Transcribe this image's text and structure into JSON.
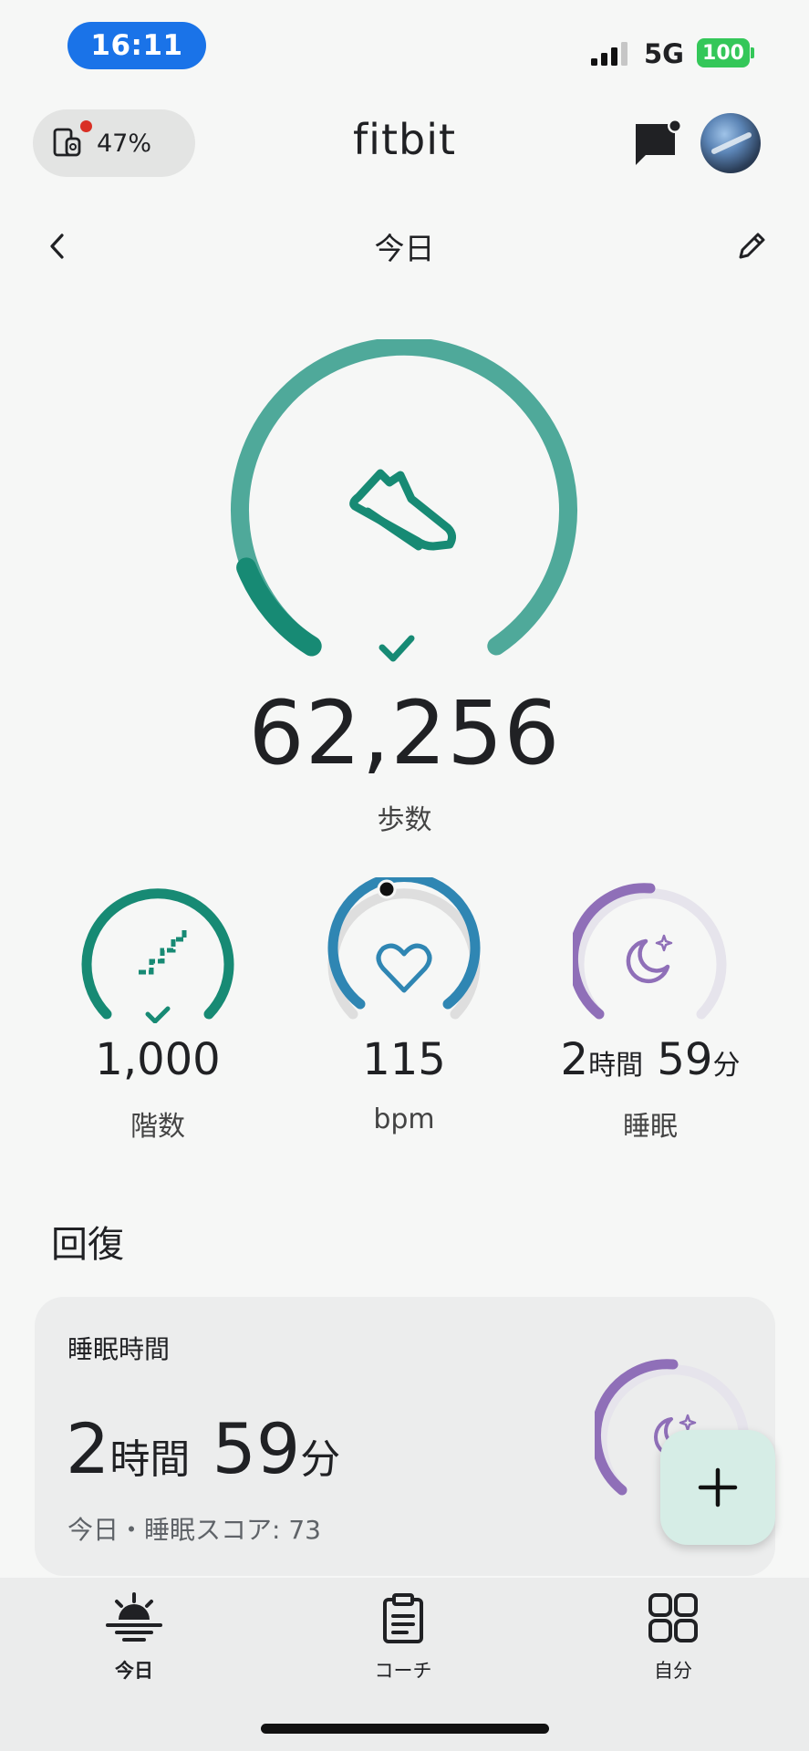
{
  "status_bar": {
    "time": "16:11",
    "network": "5G",
    "battery": "100"
  },
  "header": {
    "device_battery": "47%",
    "brand": "fitbit"
  },
  "date_nav": {
    "title": "今日"
  },
  "steps": {
    "value": "62,256",
    "label": "歩数",
    "goal_met": true
  },
  "stats": {
    "floors": {
      "value": "1,000",
      "label": "階数",
      "goal_met": true
    },
    "heart": {
      "value": "115",
      "label": "bpm"
    },
    "sleep": {
      "hours": "2",
      "hours_unit": "時間",
      "minutes": "59",
      "minutes_unit": "分",
      "label": "睡眠"
    }
  },
  "recovery": {
    "section_title": "回復",
    "card_title": "睡眠時間",
    "hours": "2",
    "hours_unit": "時間",
    "minutes": "59",
    "minutes_unit": "分",
    "subtitle": "今日・睡眠スコア: 73"
  },
  "bottom_nav": {
    "tabs": [
      {
        "label": "今日",
        "icon": "sunrise-icon",
        "active": true
      },
      {
        "label": "コーチ",
        "icon": "clipboard-icon",
        "active": false
      },
      {
        "label": "自分",
        "icon": "grid-icon",
        "active": false
      }
    ]
  },
  "colors": {
    "steps_ring": "#4fa99a",
    "steps_progress": "#178a74",
    "floors_ring": "#178a74",
    "heart_ring": "#2f86b3",
    "sleep_ring": "#8f6fb8",
    "track": "#dedede"
  }
}
